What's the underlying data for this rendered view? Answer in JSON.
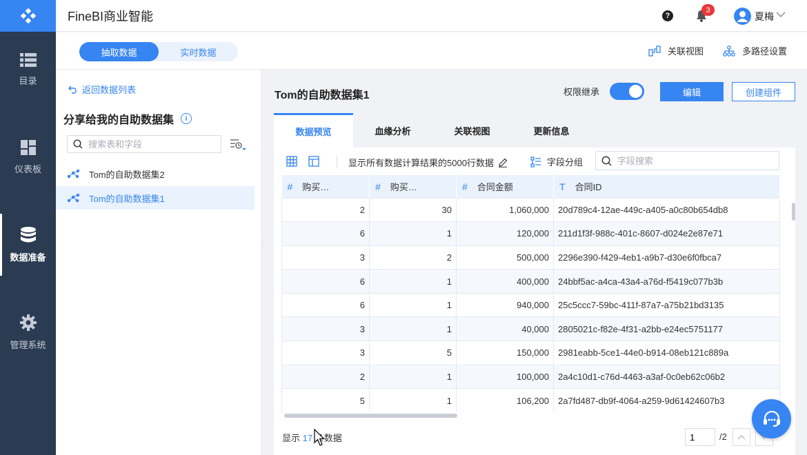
{
  "colors": {
    "accent": "#3685f2",
    "nav_bg": "#2b3b52",
    "badge": "#e8393a"
  },
  "app": {
    "title": "FineBI商业智能"
  },
  "header": {
    "notification_count": "3",
    "user_name": "夏梅"
  },
  "nav": [
    {
      "label": "目录",
      "icon": "list-icon"
    },
    {
      "label": "仪表板",
      "icon": "dashboard-icon"
    },
    {
      "label": "数据准备",
      "icon": "database-icon",
      "active": true
    },
    {
      "label": "管理系统",
      "icon": "gear-icon"
    }
  ],
  "subheader": {
    "tab_extract": "抽取数据",
    "tab_realtime": "实时数据",
    "relation_view": "关联视图",
    "multipath_settings": "多路径设置"
  },
  "left_panel": {
    "back_label": "返回数据列表",
    "title": "分享给我的自助数据集",
    "search_placeholder": "搜索表和字段",
    "items": [
      {
        "label": "Tom的自助数据集2",
        "selected": false
      },
      {
        "label": "Tom的自助数据集1",
        "selected": true
      }
    ]
  },
  "main": {
    "title": "Tom的自助数据集1",
    "permission_label": "权限继承",
    "permission_on": true,
    "edit_label": "编辑",
    "create_label": "创建组件",
    "tabs": [
      {
        "label": "数据预览",
        "active": true
      },
      {
        "label": "血缘分析",
        "active": false
      },
      {
        "label": "关联视图",
        "active": false
      },
      {
        "label": "更新信息",
        "active": false
      }
    ],
    "toolbar": {
      "rows_label": "显示所有数据计算结果的5000行数据",
      "group_label": "字段分组",
      "field_search_placeholder": "字段搜索"
    },
    "table": {
      "columns": [
        {
          "type": "#",
          "label": "购买…"
        },
        {
          "type": "#",
          "label": "购买…"
        },
        {
          "type": "#",
          "label": "合同金额"
        },
        {
          "type": "T",
          "label": "合同ID"
        }
      ],
      "rows": [
        [
          "2",
          "30",
          "1,060,000",
          "20d789c4-12ae-449c-a405-a0c80b654db8"
        ],
        [
          "6",
          "1",
          "120,000",
          "211d1f3f-988c-401c-8607-d024e2e87e71"
        ],
        [
          "3",
          "2",
          "500,000",
          "2296e390-f429-4eb1-a9b7-d30e6f0fbca7"
        ],
        [
          "6",
          "1",
          "400,000",
          "24bbf5ac-a4ca-43a4-a76d-f5419c077b3b"
        ],
        [
          "6",
          "1",
          "940,000",
          "25c5ccc7-59bc-411f-87a7-a75b21bd3135"
        ],
        [
          "3",
          "1",
          "40,000",
          "2805021c-f82e-4f31-a2bb-e24ec5751177"
        ],
        [
          "3",
          "5",
          "150,000",
          "2981eabb-5ce1-44e0-b914-08eb121c889a"
        ],
        [
          "2",
          "1",
          "100,000",
          "2a4c10d1-c76d-4463-a3af-0c0eb62c06b2"
        ],
        [
          "5",
          "1",
          "106,200",
          "2a7fd487-db9f-4064-a259-9d61424607b3"
        ]
      ]
    },
    "footer": {
      "prefix": "显示",
      "count": "17",
      "suffix": "条数据",
      "page_value": "1",
      "page_total": "/2"
    }
  }
}
